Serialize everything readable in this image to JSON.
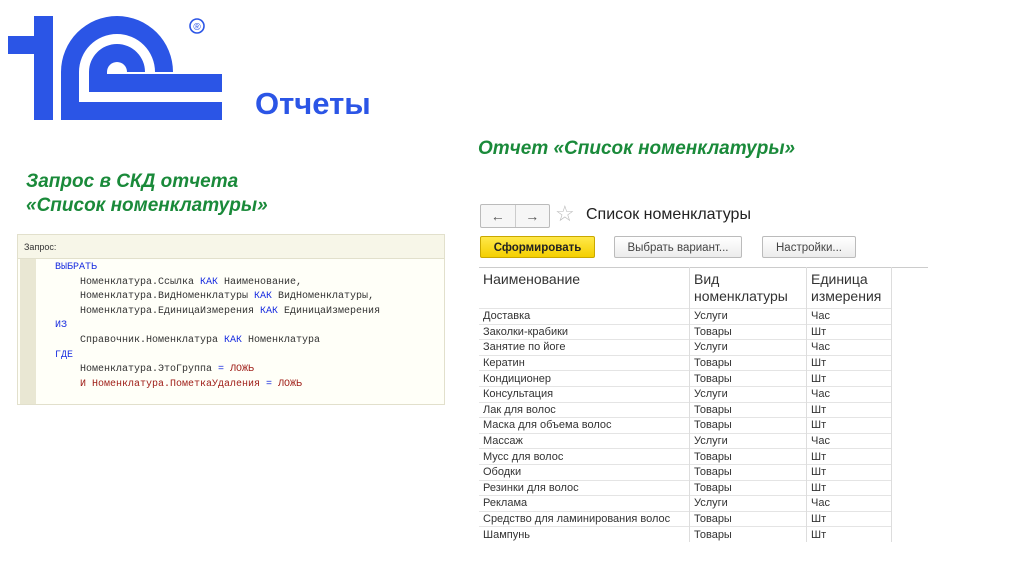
{
  "logo": {
    "text": "1С",
    "registered": "®"
  },
  "title": "Отчеты",
  "left_heading": {
    "line1": "Запрос  в СКД отчета",
    "line2": "«Список номенклатуры»"
  },
  "right_heading": "Отчет «Список номенклатуры»",
  "query": {
    "label": "Запрос:",
    "lines": [
      {
        "kw": "ВЫБРАТЬ",
        "text": ""
      },
      {
        "text": "Номенклатура.Ссылка ",
        "kw2": "КАК",
        "text2": " Наименование,"
      },
      {
        "text": "Номенклатура.ВидНоменклатуры ",
        "kw2": "КАК",
        "text2": " ВидНоменклатуры,"
      },
      {
        "text": "Номенклатура.ЕдиницаИзмерения ",
        "kw2": "КАК",
        "text2": " ЕдиницаИзмерения"
      },
      {
        "kw": "ИЗ",
        "text": ""
      },
      {
        "text": "Справочник.Номенклатура ",
        "kw2": "КАК",
        "text2": " Номенклатура"
      },
      {
        "kw": "ГДЕ",
        "text": ""
      },
      {
        "text": "Номенклатура.ЭтоГруппа ",
        "kw2": "=",
        "text2": " ЛОЖЬ"
      },
      {
        "text": "И Номенклатура.ПометкаУдаления ",
        "kw2": "=",
        "text2": " ЛОЖЬ"
      }
    ]
  },
  "form": {
    "back": "←",
    "forward": "→",
    "title": "Список номенклатуры",
    "btn_generate": "Сформировать",
    "btn_variant": "Выбрать вариант...",
    "btn_settings": "Настройки..."
  },
  "table": {
    "headers": [
      "Наименование",
      "Вид номенклатуры",
      "Единица измерения"
    ],
    "rows": [
      [
        "Доставка",
        "Услуги",
        "Час"
      ],
      [
        "Заколки-крабики",
        "Товары",
        "Шт"
      ],
      [
        "Занятие по йоге",
        "Услуги",
        "Час"
      ],
      [
        "Кератин",
        "Товары",
        "Шт"
      ],
      [
        "Кондиционер",
        "Товары",
        "Шт"
      ],
      [
        "Консультация",
        "Услуги",
        "Час"
      ],
      [
        "Лак для волос",
        "Товары",
        "Шт"
      ],
      [
        "Маска для объема волос",
        "Товары",
        "Шт"
      ],
      [
        "Массаж",
        "Услуги",
        "Час"
      ],
      [
        "Мусс для волос",
        "Товары",
        "Шт"
      ],
      [
        "Ободки",
        "Товары",
        "Шт"
      ],
      [
        "Резинки для волос",
        "Товары",
        "Шт"
      ],
      [
        "Реклама",
        "Услуги",
        "Час"
      ],
      [
        "Средство для ламинирования волос",
        "Товары",
        "Шт"
      ],
      [
        "Шампунь",
        "Товары",
        "Шт"
      ]
    ]
  }
}
